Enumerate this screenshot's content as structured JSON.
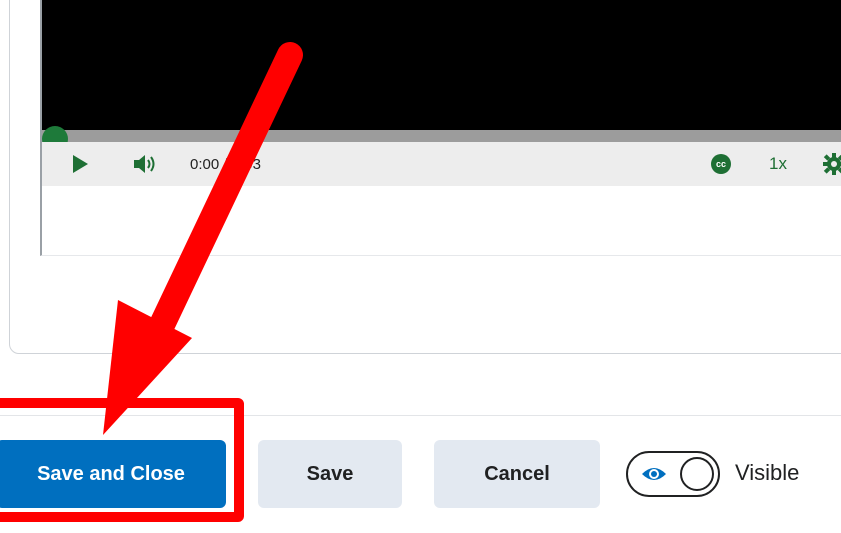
{
  "player": {
    "current_time": "0:00",
    "separator": " / ",
    "duration": "0:03",
    "playback_speed": "1x",
    "captions_label": "cc",
    "progress_fraction": 0,
    "accent_color": "#1e6f34"
  },
  "actions": {
    "save_and_close_label": "Save and Close",
    "save_label": "Save",
    "cancel_label": "Cancel",
    "visibility_label": "Visible",
    "visibility_on": true,
    "primary_color": "#006fbf"
  },
  "annotation": {
    "color": "#ff0000"
  }
}
